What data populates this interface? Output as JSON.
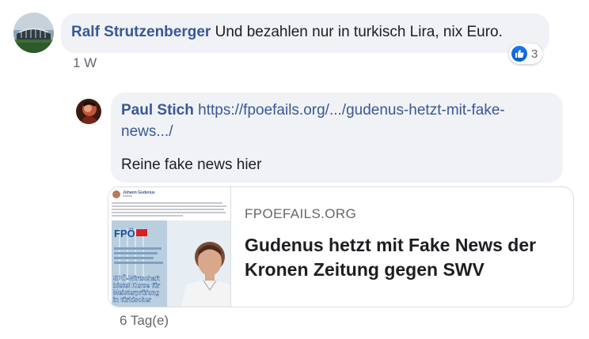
{
  "comments": [
    {
      "author": "Ralf Strutzenberger",
      "text": "Und bezahlen nur in turkisch Lira, nix Euro.",
      "time": "1 W",
      "reaction_icon": "like-icon",
      "reaction_count": "3"
    },
    {
      "author": "Paul Stich",
      "link": "https://fpoefails.org/.../gudenus-hetzt-mit-fake-news.../",
      "text": "Reine fake news hier",
      "time": "6 Tag(e)",
      "link_preview": {
        "domain": "FPOEFAILS.ORG",
        "title": "Gudenus hetzt mit Fake News der Kronen Zeitung gegen SWV",
        "thumbnail": {
          "author": "Johann Gudenus",
          "logo": "FPÖ",
          "headline_lines": [
            "SPÖ-Wirtschaft",
            "bietet Kurse für",
            "Meisterprüfung",
            "in türkischer"
          ]
        }
      }
    }
  ],
  "colors": {
    "link": "#385898",
    "bubble": "#f0f2f5",
    "meta": "#65676b",
    "like": "#1877f2"
  }
}
